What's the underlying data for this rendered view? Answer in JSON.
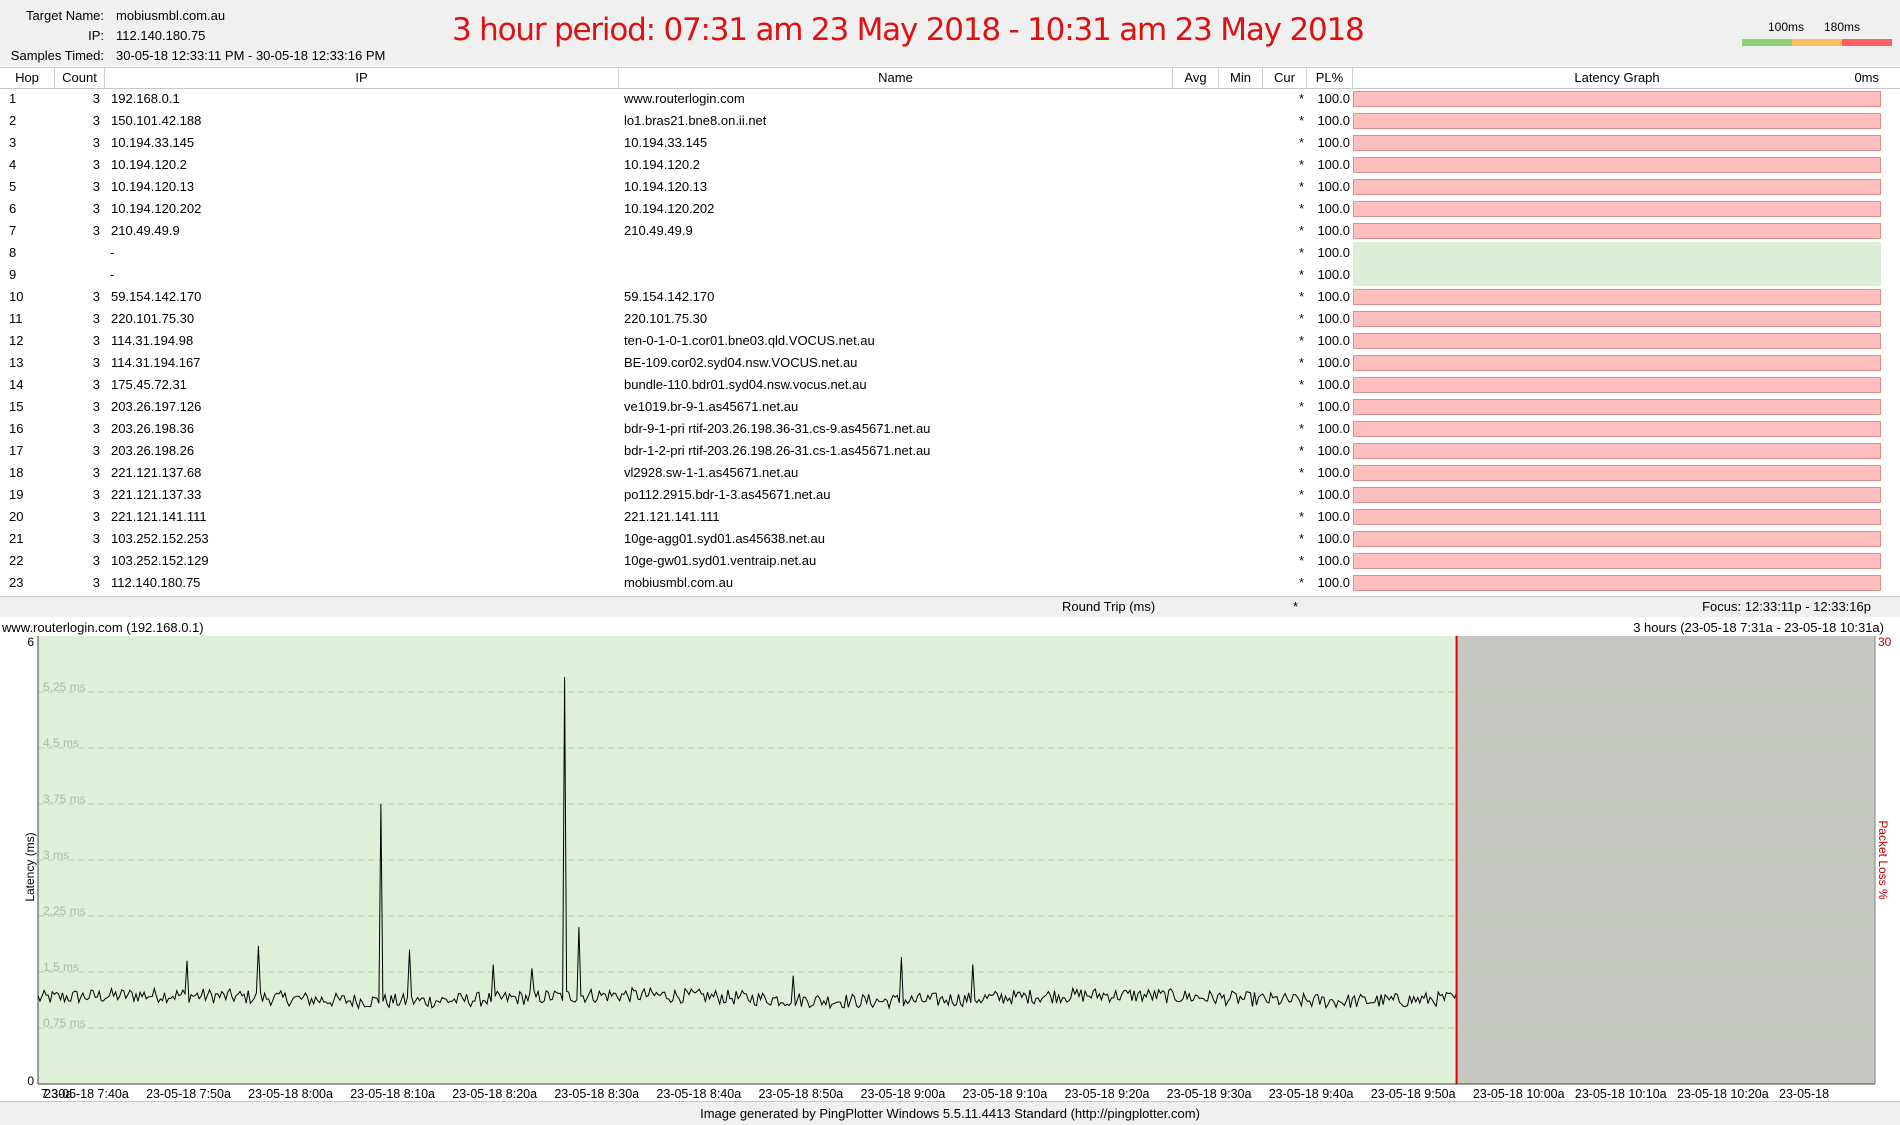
{
  "header": {
    "target_label": "Target Name:",
    "target_value": "mobiusmbl.com.au",
    "ip_label": "IP:",
    "ip_value": "112.140.180.75",
    "samples_label": "Samples Timed:",
    "samples_value": "30-05-18 12:33:11 PM - 30-05-18 12:33:16 PM",
    "period_title": "3 hour period:  07:31 am 23 May 2018 - 10:31 am 23 May 2018",
    "legend_100": "100ms",
    "legend_180": "180ms",
    "legend_colors": [
      "#8fd07a",
      "#ffc060",
      "#ff6060"
    ]
  },
  "columns": {
    "hop": "Hop",
    "count": "Count",
    "ip": "IP",
    "name": "Name",
    "avg": "Avg",
    "min": "Min",
    "cur": "Cur",
    "pl": "PL%",
    "latency_graph": "Latency Graph",
    "zero_ms": "0ms"
  },
  "hops": [
    {
      "hop": "1",
      "count": "3",
      "ip": "192.168.0.1",
      "name": "www.routerlogin.com",
      "cur": "*",
      "pl": "100.0",
      "status": "loss"
    },
    {
      "hop": "2",
      "count": "3",
      "ip": "150.101.42.188",
      "name": "lo1.bras21.bne8.on.ii.net",
      "cur": "*",
      "pl": "100.0",
      "status": "loss"
    },
    {
      "hop": "3",
      "count": "3",
      "ip": "10.194.33.145",
      "name": "10.194.33.145",
      "cur": "*",
      "pl": "100.0",
      "status": "loss"
    },
    {
      "hop": "4",
      "count": "3",
      "ip": "10.194.120.2",
      "name": "10.194.120.2",
      "cur": "*",
      "pl": "100.0",
      "status": "loss"
    },
    {
      "hop": "5",
      "count": "3",
      "ip": "10.194.120.13",
      "name": "10.194.120.13",
      "cur": "*",
      "pl": "100.0",
      "status": "loss"
    },
    {
      "hop": "6",
      "count": "3",
      "ip": "10.194.120.202",
      "name": "10.194.120.202",
      "cur": "*",
      "pl": "100.0",
      "status": "loss"
    },
    {
      "hop": "7",
      "count": "3",
      "ip": "210.49.49.9",
      "name": "210.49.49.9",
      "cur": "*",
      "pl": "100.0",
      "status": "loss"
    },
    {
      "hop": "8",
      "count": "",
      "ip": "-",
      "name": "",
      "cur": "*",
      "pl": "100.0",
      "status": "ok"
    },
    {
      "hop": "9",
      "count": "",
      "ip": "-",
      "name": "",
      "cur": "*",
      "pl": "100.0",
      "status": "ok"
    },
    {
      "hop": "10",
      "count": "3",
      "ip": "59.154.142.170",
      "name": "59.154.142.170",
      "cur": "*",
      "pl": "100.0",
      "status": "loss"
    },
    {
      "hop": "11",
      "count": "3",
      "ip": "220.101.75.30",
      "name": "220.101.75.30",
      "cur": "*",
      "pl": "100.0",
      "status": "loss"
    },
    {
      "hop": "12",
      "count": "3",
      "ip": "114.31.194.98",
      "name": "ten-0-1-0-1.cor01.bne03.qld.VOCUS.net.au",
      "cur": "*",
      "pl": "100.0",
      "status": "loss"
    },
    {
      "hop": "13",
      "count": "3",
      "ip": "114.31.194.167",
      "name": "BE-109.cor02.syd04.nsw.VOCUS.net.au",
      "cur": "*",
      "pl": "100.0",
      "status": "loss"
    },
    {
      "hop": "14",
      "count": "3",
      "ip": "175.45.72.31",
      "name": "bundle-110.bdr01.syd04.nsw.vocus.net.au",
      "cur": "*",
      "pl": "100.0",
      "status": "loss"
    },
    {
      "hop": "15",
      "count": "3",
      "ip": "203.26.197.126",
      "name": "ve1019.br-9-1.as45671.net.au",
      "cur": "*",
      "pl": "100.0",
      "status": "loss"
    },
    {
      "hop": "16",
      "count": "3",
      "ip": "203.26.198.36",
      "name": "bdr-9-1-pri rtif-203.26.198.36-31.cs-9.as45671.net.au",
      "cur": "*",
      "pl": "100.0",
      "status": "loss"
    },
    {
      "hop": "17",
      "count": "3",
      "ip": "203.26.198.26",
      "name": "bdr-1-2-pri rtif-203.26.198.26-31.cs-1.as45671.net.au",
      "cur": "*",
      "pl": "100.0",
      "status": "loss"
    },
    {
      "hop": "18",
      "count": "3",
      "ip": "221.121.137.68",
      "name": "vl2928.sw-1-1.as45671.net.au",
      "cur": "*",
      "pl": "100.0",
      "status": "loss"
    },
    {
      "hop": "19",
      "count": "3",
      "ip": "221.121.137.33",
      "name": "po112.2915.bdr-1-3.as45671.net.au",
      "cur": "*",
      "pl": "100.0",
      "status": "loss"
    },
    {
      "hop": "20",
      "count": "3",
      "ip": "221.121.141.111",
      "name": "221.121.141.111",
      "cur": "*",
      "pl": "100.0",
      "status": "loss"
    },
    {
      "hop": "21",
      "count": "3",
      "ip": "103.252.152.253",
      "name": "10ge-agg01.syd01.as45638.net.au",
      "cur": "*",
      "pl": "100.0",
      "status": "loss"
    },
    {
      "hop": "22",
      "count": "3",
      "ip": "103.252.152.129",
      "name": "10ge-gw01.syd01.ventraip.net.au",
      "cur": "*",
      "pl": "100.0",
      "status": "loss"
    },
    {
      "hop": "23",
      "count": "3",
      "ip": "112.140.180.75",
      "name": "mobiusmbl.com.au",
      "cur": "*",
      "pl": "100.0",
      "status": "loss"
    }
  ],
  "round_trip": {
    "label": "Round Trip (ms)",
    "cur": "*",
    "focus": "Focus: 12:33:11p - 12:33:16p"
  },
  "graph": {
    "title": "www.routerlogin.com (192.168.0.1)",
    "range": "3 hours (23-05-18 7:31a - 23-05-18 10:31a)",
    "footer": "Image generated by PingPlotter Windows 5.5.11.4413 Standard (http://pingplotter.com)"
  },
  "chart_data": {
    "type": "line",
    "ylabel": "Latency (ms)",
    "y2label": "Packet Loss %",
    "ylim": [
      0,
      6
    ],
    "y2_max": "30",
    "y_tick_labels": [
      "0",
      "6"
    ],
    "y_grid_labels": [
      "0.75 ms",
      "1.5 ms",
      "2.25 ms",
      "3 ms",
      "3.75 ms",
      "4.5 ms",
      "5.25 ms"
    ],
    "y_grid_values": [
      0.75,
      1.5,
      2.25,
      3,
      3.75,
      4.5,
      5.25
    ],
    "x_tick_labels": [
      "7:30a",
      "23-05-18 7:40a",
      "23-05-18 7:50a",
      "23-05-18 8:00a",
      "23-05-18 8:10a",
      "23-05-18 8:20a",
      "23-05-18 8:30a",
      "23-05-18 8:40a",
      "23-05-18 8:50a",
      "23-05-18 9:00a",
      "23-05-18 9:10a",
      "23-05-18 9:20a",
      "23-05-18 9:30a",
      "23-05-18 9:40a",
      "23-05-18 9:50a",
      "23-05-18 10:00a",
      "23-05-18 10:10a",
      "23-05-18 10:20a",
      "23-05-18"
    ],
    "x_range_minutes": [
      0,
      180
    ],
    "data_end_minute": 139,
    "baseline_ms": 1.15,
    "noise_ms": 0.1,
    "spikes": [
      {
        "minute": 14.5,
        "ms": 1.65
      },
      {
        "minute": 21.5,
        "ms": 1.85
      },
      {
        "minute": 33.5,
        "ms": 3.75
      },
      {
        "minute": 36.5,
        "ms": 1.8
      },
      {
        "minute": 44.5,
        "ms": 1.6
      },
      {
        "minute": 48.3,
        "ms": 1.55
      },
      {
        "minute": 51.5,
        "ms": 5.45
      },
      {
        "minute": 53,
        "ms": 2.1
      },
      {
        "minute": 74,
        "ms": 1.45
      },
      {
        "minute": 84.5,
        "ms": 1.7
      },
      {
        "minute": 91.5,
        "ms": 1.6
      }
    ],
    "colors": {
      "bg_data": "#def0d8",
      "bg_future": "#c5c8c0",
      "line": "#000000",
      "cursor": "#e00000",
      "grid": "#b9cdb0",
      "grid_label": "#a9b9a3",
      "y2": "#c00000"
    }
  }
}
